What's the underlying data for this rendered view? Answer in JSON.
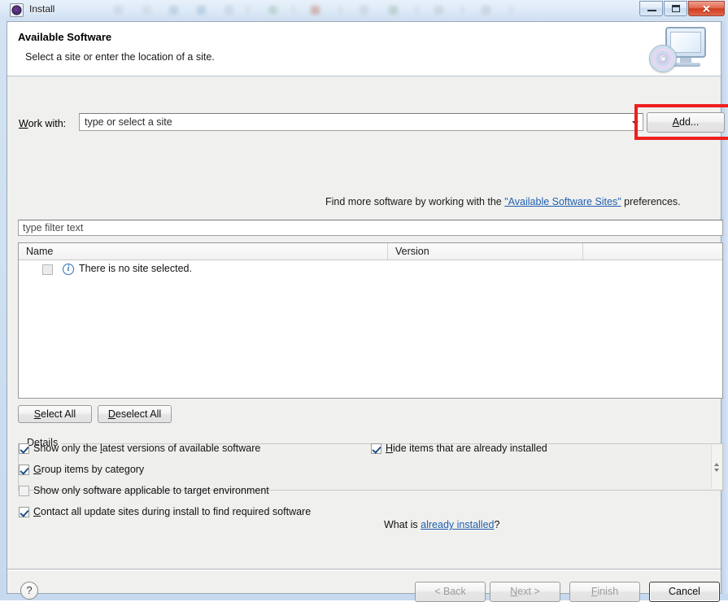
{
  "window": {
    "title": "Install",
    "icon": "eclipse-install-icon",
    "buttons": {
      "minimize": "minimize-button",
      "maximize": "maximize-button",
      "close": "✕"
    }
  },
  "header": {
    "title": "Available Software",
    "subtitle": "Select a site or enter the location of a site.",
    "banner_icon": "monitor-with-disc-icon"
  },
  "work_with": {
    "label_prefix": "W",
    "label_rest": "ork with:",
    "combo_value": "type or select a site",
    "add_button": {
      "prefix": "A",
      "rest": "dd..."
    }
  },
  "find_more": {
    "before": "Find more software by working with the ",
    "link": "\"Available Software Sites\"",
    "after": " preferences."
  },
  "filter": {
    "placeholder": "type filter text"
  },
  "table": {
    "columns": [
      "Name",
      "Version",
      ""
    ],
    "rows": [
      {
        "checkbox": "disabled",
        "icon": "info-icon",
        "name": "There is no site selected."
      }
    ]
  },
  "list_buttons": {
    "select_all": {
      "prefix": "S",
      "rest": "elect All"
    },
    "deselect_all": {
      "prefix": "D",
      "rest": "eselect All"
    }
  },
  "details": {
    "legend": "Details",
    "content": ""
  },
  "options": {
    "left": [
      {
        "checked": true,
        "prefix": "Show only the ",
        "mnemonic": "l",
        "rest": "atest versions of available software"
      },
      {
        "checked": true,
        "prefix": "",
        "mnemonic": "G",
        "rest": "roup items by category"
      },
      {
        "checked": false,
        "prefix": "",
        "mnemonic": "S",
        "rest": "how only software applicable to target environment"
      },
      {
        "checked": true,
        "prefix": "",
        "mnemonic": "C",
        "rest": "ontact all update sites during install to find required software"
      }
    ],
    "right": [
      {
        "checked": true,
        "prefix": "",
        "mnemonic": "H",
        "rest": "ide items that are already installed"
      }
    ],
    "what_is": {
      "before": "What is ",
      "link": "already installed",
      "after": "?"
    }
  },
  "footer": {
    "help": "?",
    "back": {
      "prefix": "< B",
      "mnemonic": "",
      "rest": "ack",
      "enabled": false
    },
    "next": {
      "prefix": "N",
      "mnemonic": "",
      "rest": "ext >",
      "enabled": false
    },
    "finish": {
      "prefix": "F",
      "mnemonic": "",
      "rest": "inish",
      "enabled": false
    },
    "cancel": {
      "label": "Cancel",
      "enabled": true
    }
  },
  "annotation": {
    "highlight_color": "#ee1f1f",
    "target": "add-button"
  }
}
